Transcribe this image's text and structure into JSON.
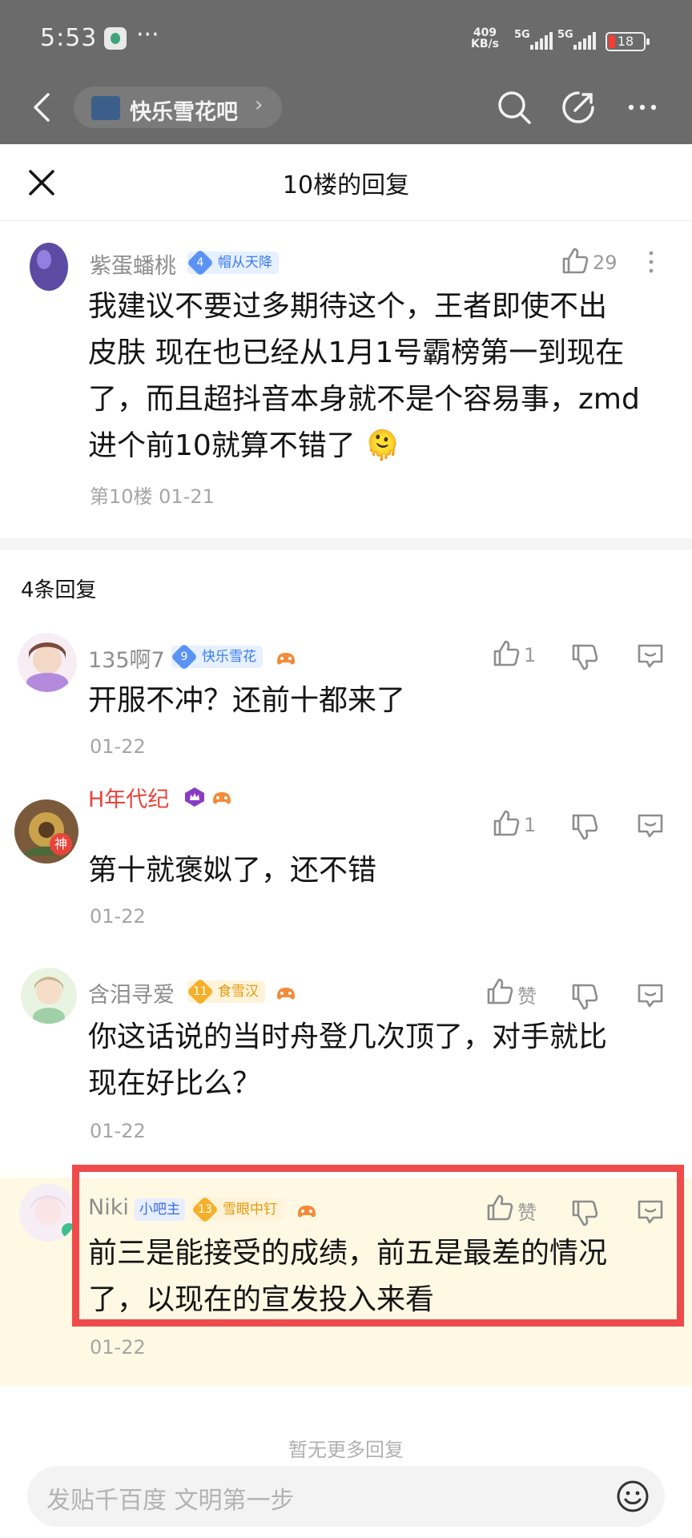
{
  "status_bar": {
    "time": "5:53",
    "overflow": "···",
    "net_speed_value": "409",
    "net_speed_unit": "KB/s",
    "sim1": "5G",
    "sim2": "5G",
    "battery": "18",
    "battery_color": "#ff3b30"
  },
  "top_nav": {
    "forum_name": "快乐雪花吧",
    "icons": [
      "back-icon",
      "search-icon",
      "compose-icon",
      "more-icon"
    ]
  },
  "sheet": {
    "title": "10楼的回复",
    "close_icon": "close-icon"
  },
  "main_post": {
    "user": "紫蛋蟠桃",
    "level": "4",
    "badge": "帽从天降",
    "likes": "29",
    "text_lines": [
      "我建议不要过多期待这个，王者即使不出",
      "皮肤 现在也已经从1月1号霸榜第一到现在",
      "了，而且超抖音本身就不是个容易事，zmd",
      "进个前10就算不错了 🫠"
    ],
    "meta": "第10楼 01-21"
  },
  "reply_count": "4条回复",
  "replies": [
    {
      "user": "135啊7",
      "level": "9",
      "badge": "快乐雪花",
      "badge_style": "blue",
      "like": "1",
      "text_lines": [
        "开服不冲？还前十都来了"
      ],
      "date": "01-22"
    },
    {
      "user": "H年代纪",
      "avatar_tag": "神",
      "like": "1",
      "text_lines": [
        "第十就褒姒了，还不错"
      ],
      "date": "01-22"
    },
    {
      "user": "含泪寻爱",
      "level": "11",
      "badge": "食雪汉",
      "badge_style": "gold",
      "like": "赞",
      "text_lines": [
        "你这话说的当时舟登几次顶了，对手就比",
        "现在好比么？"
      ],
      "date": "01-22"
    },
    {
      "user": "Niki",
      "role": "小吧主",
      "level": "13",
      "badge": "雪眼中钉",
      "badge_style": "gold",
      "like": "赞",
      "text_lines": [
        "前三是能接受的成绩，前五是最差的情况",
        "了，以现在的宣发投入来看"
      ],
      "date": "01-22"
    }
  ],
  "no_more": "暂无更多回复",
  "composer": {
    "placeholder": "发贴千百度 文明第一步",
    "emoji_icon": "emoji-icon"
  },
  "colors": {
    "highlight_bg": "#fff9e3",
    "annotation_box": "#ef4b4b",
    "admin_name": "#e8443b"
  }
}
